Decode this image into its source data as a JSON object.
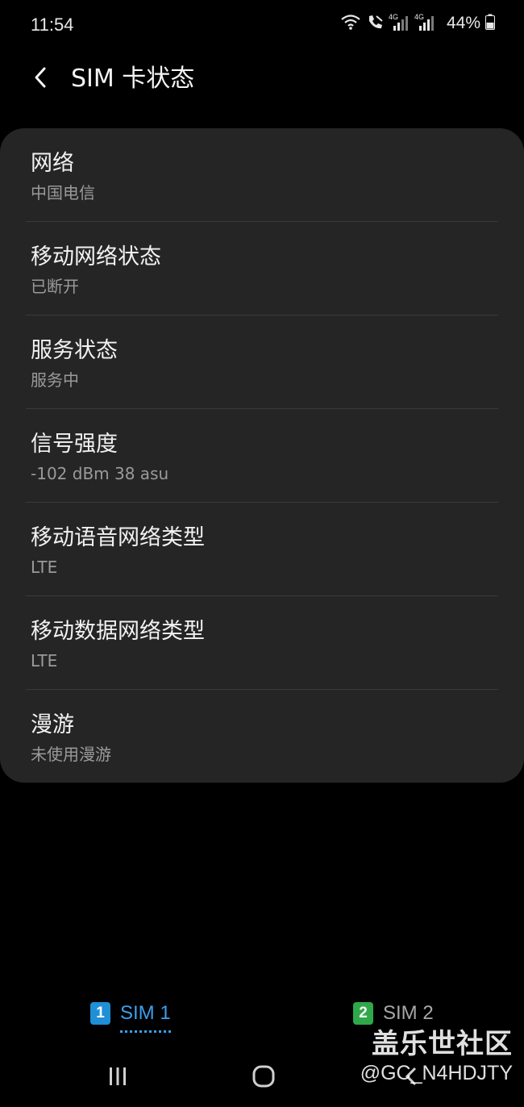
{
  "status_bar": {
    "time": "11:54",
    "battery_percent": "44%",
    "icons": [
      "wifi-icon",
      "call-icon",
      "signal-4g-sim1-icon",
      "signal-4g-sim2-icon",
      "battery-icon"
    ],
    "network_label_1": "4G",
    "network_label_2": "4G"
  },
  "header": {
    "title": "SIM 卡状态",
    "back_icon": "chevron-left-icon"
  },
  "items": [
    {
      "title": "网络",
      "value": "中国电信"
    },
    {
      "title": "移动网络状态",
      "value": "已断开"
    },
    {
      "title": "服务状态",
      "value": "服务中"
    },
    {
      "title": "信号强度",
      "value": "-102 dBm 38 asu"
    },
    {
      "title": "移动语音网络类型",
      "value": "LTE"
    },
    {
      "title": "移动数据网络类型",
      "value": "LTE"
    },
    {
      "title": "漫游",
      "value": "未使用漫游"
    }
  ],
  "sim_tabs": [
    {
      "badge": "1",
      "label": "SIM 1",
      "selected": true
    },
    {
      "badge": "2",
      "label": "SIM 2",
      "selected": false
    }
  ],
  "nav_bar": {
    "icons": [
      "recent-apps-icon",
      "home-icon",
      "back-icon"
    ]
  },
  "watermark": {
    "site": "盖乐世社区",
    "user": "@GC_N4HDJTY"
  },
  "colors": {
    "background": "#000000",
    "card": "#252525",
    "accent": "#3aa0f0",
    "sim1_badge": "#1f8fd6",
    "sim2_badge": "#2fa84a"
  }
}
